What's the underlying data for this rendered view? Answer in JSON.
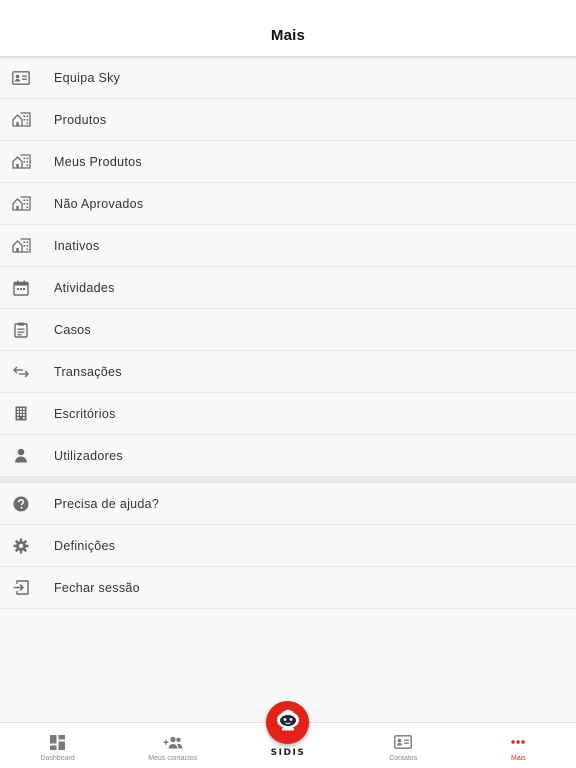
{
  "header": {
    "title": "Mais"
  },
  "menu_primary": [
    {
      "label": "Equipa Sky",
      "icon": "id-card-icon"
    },
    {
      "label": "Produtos",
      "icon": "building-icon"
    },
    {
      "label": "Meus Produtos",
      "icon": "building-icon"
    },
    {
      "label": "Não Aprovados",
      "icon": "building-icon"
    },
    {
      "label": "Inativos",
      "icon": "building-icon"
    },
    {
      "label": "Atividades",
      "icon": "calendar-icon"
    },
    {
      "label": "Casos",
      "icon": "clipboard-icon"
    },
    {
      "label": "Transações",
      "icon": "swap-arrows-icon"
    },
    {
      "label": "Escritórios",
      "icon": "office-grid-icon"
    },
    {
      "label": "Utilizadores",
      "icon": "user-icon"
    }
  ],
  "menu_secondary": [
    {
      "label": "Precisa de ajuda?",
      "icon": "help-circle-icon"
    },
    {
      "label": "Definições",
      "icon": "gear-icon"
    },
    {
      "label": "Fechar sessão",
      "icon": "logout-icon"
    }
  ],
  "tabbar": {
    "tabs": [
      {
        "label": "Dashboard",
        "icon": "dashboard-icon",
        "active": false
      },
      {
        "label": "Meus contactos",
        "icon": "add-contacts-icon",
        "active": false
      },
      {
        "label": "",
        "icon": "sidis-robot-icon",
        "active": false
      },
      {
        "label": "Contatos",
        "icon": "contact-card-icon",
        "active": false
      },
      {
        "label": "Mais",
        "icon": "more-dots-icon",
        "active": true
      }
    ],
    "brand": "SIDIS"
  },
  "colors": {
    "accent": "#e2231a",
    "icon": "#6b6b6b",
    "background": "#f8f8f8"
  }
}
